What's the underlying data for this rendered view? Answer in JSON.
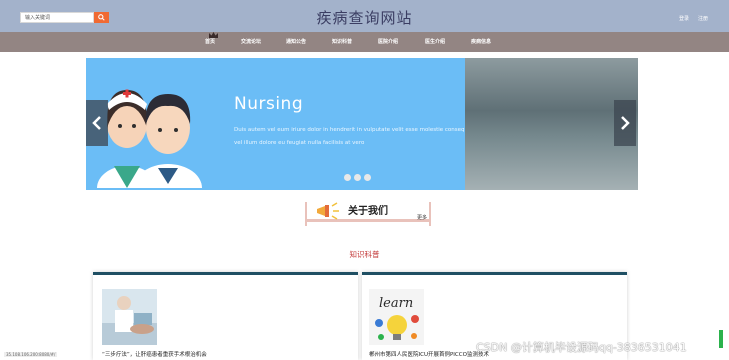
{
  "header": {
    "search_placeholder": "输入关键词",
    "site_title": "疾病查询网站",
    "login": "登录",
    "register": "注册"
  },
  "nav": {
    "items": [
      "首页",
      "交流论坛",
      "通知公告",
      "知识科普",
      "医院介绍",
      "医生介绍",
      "疾病信息"
    ]
  },
  "banner": {
    "title": "Nursing",
    "text": "Duis autem vel eum iriure dolor in hendrerit in vulputate velit esse molestie consequat, vel illum dolore eu feugiat nulla facilisis at vero",
    "slide_count": 3
  },
  "about": {
    "title": "关于我们",
    "more": "更多"
  },
  "knowledge": {
    "title": "知识科普",
    "cards": [
      {
        "caption": "“三步疗法”，让肝癌患者重获手术根治机会"
      },
      {
        "caption": "郴州市第四人民医院ICU开展首例PICCO监测技术"
      }
    ]
  },
  "status": {
    "coordinates": "35.108.106.200:8080/#/"
  },
  "watermark": "CSDN @计算机毕设源码qq-3836531041",
  "colors": {
    "header_bg": "#a3b2cb",
    "nav_bg": "#938583",
    "banner_bg": "#6bbdf6",
    "search_button": "#f06a33",
    "accent_red": "#c33a3a"
  }
}
